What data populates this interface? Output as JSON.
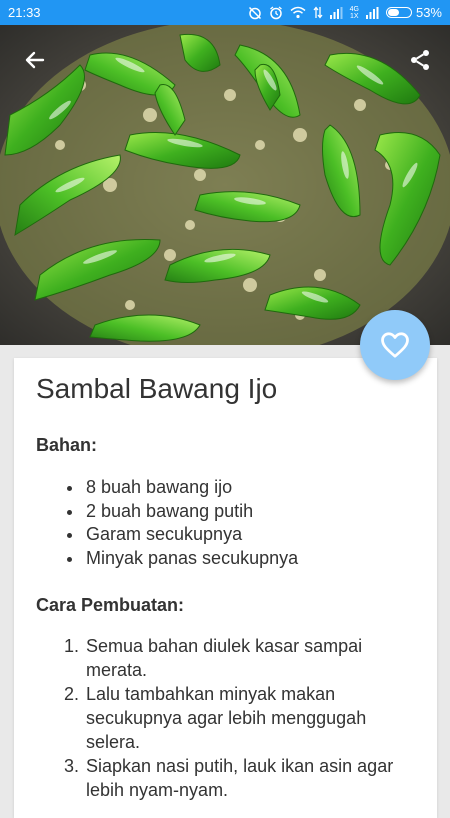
{
  "status_bar": {
    "time": "21:33",
    "network_type": "4G",
    "network_sub": "1X",
    "battery_percent": "53%",
    "battery_level": 0.53,
    "background_color": "#2196f3"
  },
  "header": {
    "back_icon": "arrow-back-icon",
    "share_icon": "share-icon",
    "image_subject": "green chili sambal in a stone mortar"
  },
  "favorite": {
    "icon": "heart-outline-icon",
    "color": "#90caf9"
  },
  "recipe": {
    "title": "Sambal Bawang Ijo",
    "ingredients_heading": "Bahan:",
    "ingredients": [
      "8 buah bawang ijo",
      "2 buah bawang putih",
      "Garam secukupnya",
      "Minyak panas secukupnya"
    ],
    "steps_heading": "Cara Pembuatan:",
    "steps": [
      "Semua bahan diulek kasar sampai merata.",
      "Lalu tambahkan minyak makan secukupnya agar lebih menggugah selera.",
      "Siapkan nasi putih, lauk ikan asin agar lebih nyam-nyam."
    ]
  }
}
